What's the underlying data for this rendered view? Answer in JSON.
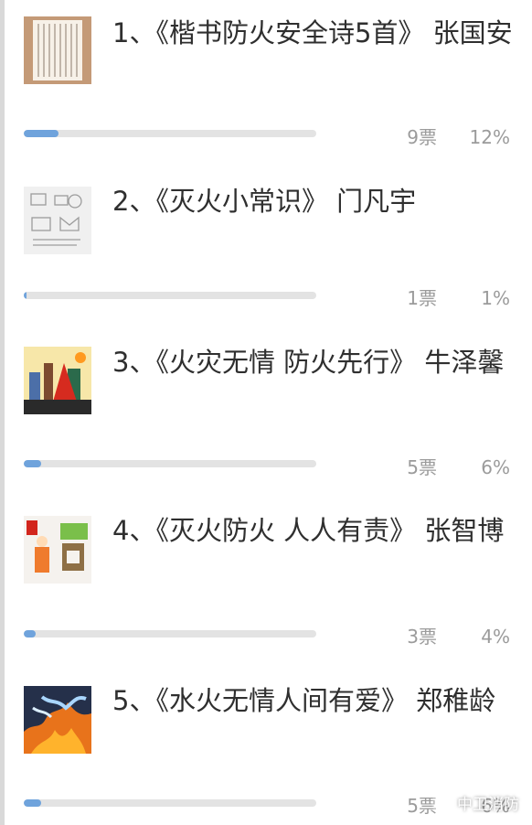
{
  "poll": {
    "items": [
      {
        "title": "1、《楷书防火安全诗5首》 张国安",
        "votes": "9票",
        "percent": "12%",
        "fraction": 0.12,
        "thumbnail": "calligraphy-poem-thumbnail"
      },
      {
        "title": "2、《灭火小常识》 门凡宇",
        "votes": "1票",
        "percent": "1%",
        "fraction": 0.01,
        "thumbnail": "fire-tips-sketch-thumbnail"
      },
      {
        "title": "3、《火灾无情 防火先行》 牛泽馨",
        "votes": "5票",
        "percent": "6%",
        "fraction": 0.06,
        "thumbnail": "fire-city-drawing-thumbnail"
      },
      {
        "title": "4、《灭火防火 人人有责》 张智博",
        "votes": "3票",
        "percent": "4%",
        "fraction": 0.04,
        "thumbnail": "firefighter-poster-thumbnail"
      },
      {
        "title": "5、《水火无情人间有爱》 郑稚龄",
        "votes": "5票",
        "percent": "6%",
        "fraction": 0.06,
        "thumbnail": "fire-painting-thumbnail"
      }
    ]
  },
  "watermark": {
    "text": "中卫消防",
    "icon": "wechat-channel-icon"
  },
  "colors": {
    "bar_fill": "#6fa3dc",
    "bar_track": "#e3e3e3",
    "meta_text": "#9b9b9b",
    "title_text": "#2f2f2f"
  }
}
